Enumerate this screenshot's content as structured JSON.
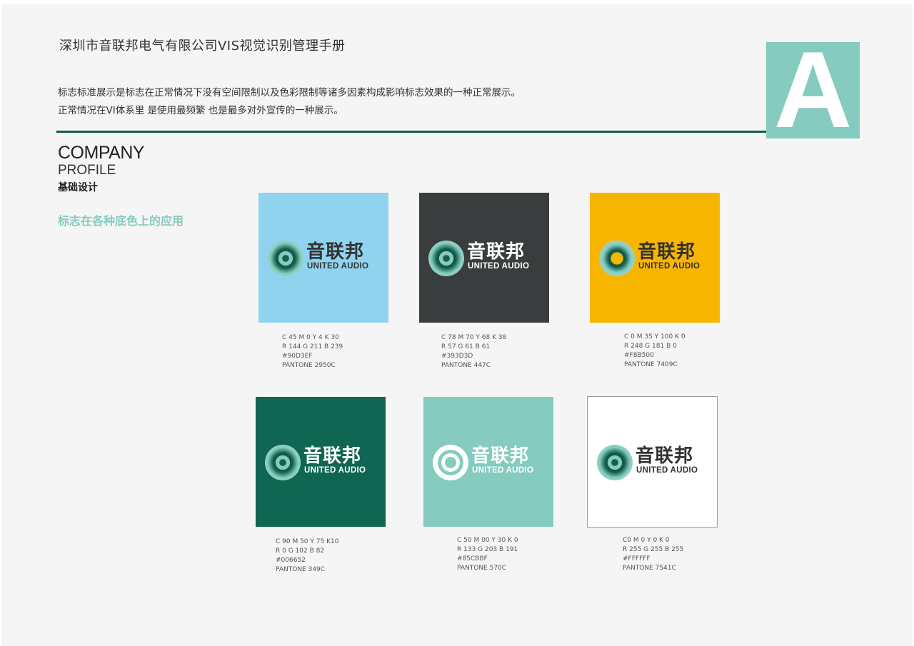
{
  "header": {
    "title": "深圳市音联邦电气有限公司VIS视觉识别管理手册",
    "intro_line1": "标志标准展示是标志在正常情况下没有空间限制以及色彩限制等诸多因素构成影响标志效果的一种正常展示。",
    "intro_line2": "正常情况在VI体系里 是使用最频繁 也是最多对外宣传的一种展示。",
    "section_letter": "A"
  },
  "section": {
    "company": "COMPANY",
    "profile": "PROFILE",
    "basic": "基础设计",
    "subtitle": "标志在各种底色上的应用"
  },
  "colors": {
    "accent": "#85CBBF",
    "rule": "#0F5C4A"
  },
  "logo": {
    "name_cn": "音联邦",
    "name_en": "UNITED AUDIO"
  },
  "swatches": [
    {
      "bg": "#90D3EF",
      "text_color": "#333333",
      "ring": "default",
      "cmyk": "C 45    M 0    Y 4    K 30",
      "rgb": "R 144    G 211    B 239",
      "hex": "#90D3EF",
      "pantone": "PANTONE 2950C"
    },
    {
      "bg": "#393D3D",
      "text_color": "#FFFFFF",
      "ring": "default",
      "cmyk": "C 78    M 70    Y 68    K 38",
      "rgb": "R 57    G 61    B 61",
      "hex": "#393D3D",
      "pantone": "PANTONE 447C"
    },
    {
      "bg": "#F8B500",
      "text_color": "#333333",
      "ring": "yellow",
      "cmyk": "C 0    M 35    Y 100    K 0",
      "rgb": "R 248    G 181    B 0",
      "hex": "#F8B500",
      "pantone": "PANTONE 7409C"
    },
    {
      "bg": "#0F6652",
      "text_color": "#FFFFFF",
      "ring": "default",
      "cmyk": "C 90    M 50    Y 75    K10",
      "rgb": "R 0    G 102    B 82",
      "hex": "#006652",
      "pantone": "PANTONE 349C"
    },
    {
      "bg": "#85CBBF",
      "text_color": "#FFFFFF",
      "ring": "white",
      "cmyk": "C 50    M 00    Y 30    K 0",
      "rgb": "R 133    G 203    B 191",
      "hex": "#85CBBF",
      "pantone": "PANTONE 570C"
    },
    {
      "bg": "#FFFFFF",
      "text_color": "#333333",
      "ring": "default",
      "cmyk": "C0    M 0    Y 0    K 0",
      "rgb": "R 255    G 255    B 255",
      "hex": "#FFFFFF",
      "pantone": "PANTONE 7541C"
    }
  ]
}
